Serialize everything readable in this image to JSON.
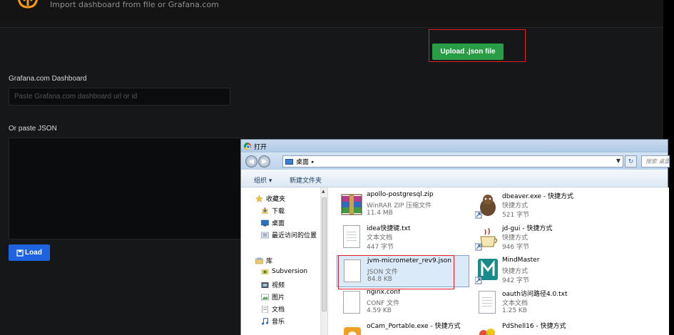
{
  "page": {
    "subtitle": "Import dashboard from file or Grafana.com",
    "upload_label": "Upload .json file",
    "gcom_label": "Grafana.com Dashboard",
    "gcom_placeholder": "Paste Grafana.com dashboard url or id",
    "json_label": "Or paste JSON",
    "load_label": "Load"
  },
  "dialog": {
    "title": "打开",
    "address": "桌面",
    "search_placeholder": "搜索 桌面",
    "toolbar": {
      "organize": "组织 ▾",
      "new_folder": "新建文件夹"
    },
    "sidebar": [
      {
        "label": "收藏夹",
        "icon": "star-icon"
      },
      {
        "label": "下载",
        "icon": "download-folder-icon"
      },
      {
        "label": "桌面",
        "icon": "desktop-icon"
      },
      {
        "label": "最近访问的位置",
        "icon": "recent-places-icon"
      },
      {
        "label": "库",
        "icon": "library-icon"
      },
      {
        "label": "Subversion",
        "icon": "subversion-icon"
      },
      {
        "label": "视频",
        "icon": "video-library-icon"
      },
      {
        "label": "图片",
        "icon": "pictures-library-icon"
      },
      {
        "label": "文档",
        "icon": "documents-library-icon"
      },
      {
        "label": "音乐",
        "icon": "music-library-icon"
      }
    ],
    "files": [
      {
        "name": "apollo-postgresql.zip",
        "type": "WinRAR ZIP 压缩文件",
        "size": "11.4 MB",
        "icon": "winrar-archive-icon"
      },
      {
        "name": "dbeaver.exe - 快捷方式",
        "type": "快捷方式",
        "size": "521 字节",
        "icon": "dbeaver-shortcut-icon"
      },
      {
        "name": "idea快捷键.txt",
        "type": "文本文档",
        "size": "447 字节",
        "icon": "text-document-icon"
      },
      {
        "name": "jd-gui - 快捷方式",
        "type": "快捷方式",
        "size": "946 字节",
        "icon": "jd-gui-shortcut-icon"
      },
      {
        "name": "jvm-micrometer_rev9.json",
        "type": "JSON 文件",
        "size": "84.8 KB",
        "icon": "json-file-icon"
      },
      {
        "name": "MindMaster",
        "type": "快捷方式",
        "size": "942 字节",
        "icon": "mindmaster-shortcut-icon"
      },
      {
        "name": "nginx.conf",
        "type": "CONF 文件",
        "size": "4.59 KB",
        "icon": "conf-file-icon"
      },
      {
        "name": "oauth访问路径4.0.txt",
        "type": "文本文档",
        "size": "1.25 KB",
        "icon": "text-document-icon"
      },
      {
        "name": "oCam_Portable.exe - 快捷方式",
        "type": "",
        "size": "",
        "icon": "ocam-shortcut-icon"
      },
      {
        "name": "PdShell16 - 快捷方式",
        "type": "",
        "size": "",
        "icon": "pdshell-shortcut-icon"
      }
    ]
  },
  "colors": {
    "upload_green": "#299c46",
    "load_blue": "#1f62e0",
    "highlight_red": "#e21d2a"
  }
}
